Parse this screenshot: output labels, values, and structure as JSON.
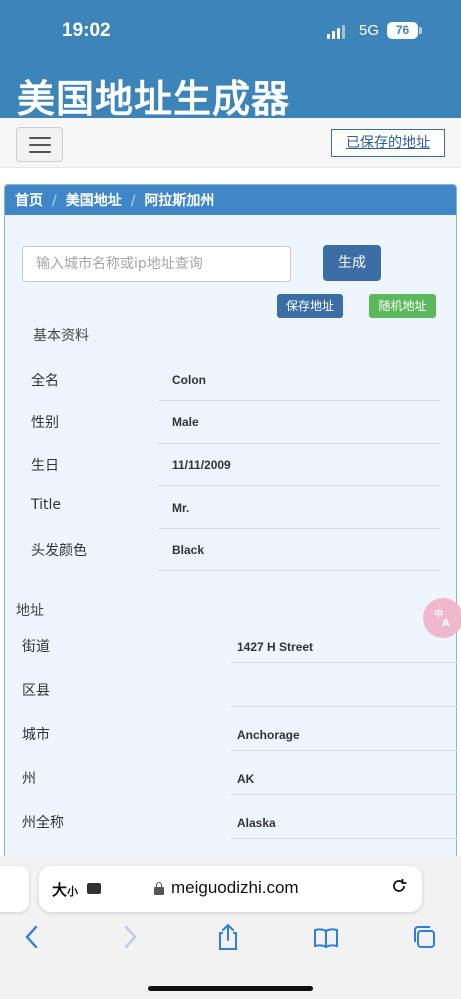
{
  "status_bar": {
    "time": "19:02",
    "network": "5G",
    "battery": "76"
  },
  "app_title": "美国地址生成器",
  "nav": {
    "saved_link": "已保存的地址"
  },
  "breadcrumb": {
    "items": [
      "首页",
      "美国地址",
      "阿拉斯加州"
    ],
    "separator": "/"
  },
  "search": {
    "placeholder": "输入城市名称或ip地址查询",
    "value": ""
  },
  "buttons": {
    "generate": "生成",
    "save": "保存地址",
    "random": "随机地址"
  },
  "basic_info": {
    "title": "基本资料",
    "rows": [
      {
        "label": "全名",
        "value": "Colon"
      },
      {
        "label": "性别",
        "value": "Male"
      },
      {
        "label": "生日",
        "value": "11/11/2009"
      },
      {
        "label": "Title",
        "value": "Mr."
      },
      {
        "label": "头发颜色",
        "value": "Black"
      }
    ]
  },
  "address": {
    "title": "地址",
    "rows": [
      {
        "label": "街道",
        "value": "1427 H Street"
      },
      {
        "label": "区县",
        "value": ""
      },
      {
        "label": "城市",
        "value": "Anchorage"
      },
      {
        "label": "州",
        "value": "AK"
      },
      {
        "label": "州全称",
        "value": "Alaska"
      }
    ]
  },
  "browser": {
    "text_size": "大",
    "text_size_small": "小",
    "url": "meiguodizhi.com"
  },
  "colors": {
    "header": "#3d85b8",
    "primary_button": "#3a6ea5",
    "success_button": "#5cb85c",
    "browser_tint": "#2f7de1"
  },
  "icons": [
    "menu-icon",
    "lock-icon",
    "reload-icon",
    "back-icon",
    "forward-icon",
    "share-icon",
    "bookmarks-icon",
    "tabs-icon",
    "translate-icon"
  ]
}
